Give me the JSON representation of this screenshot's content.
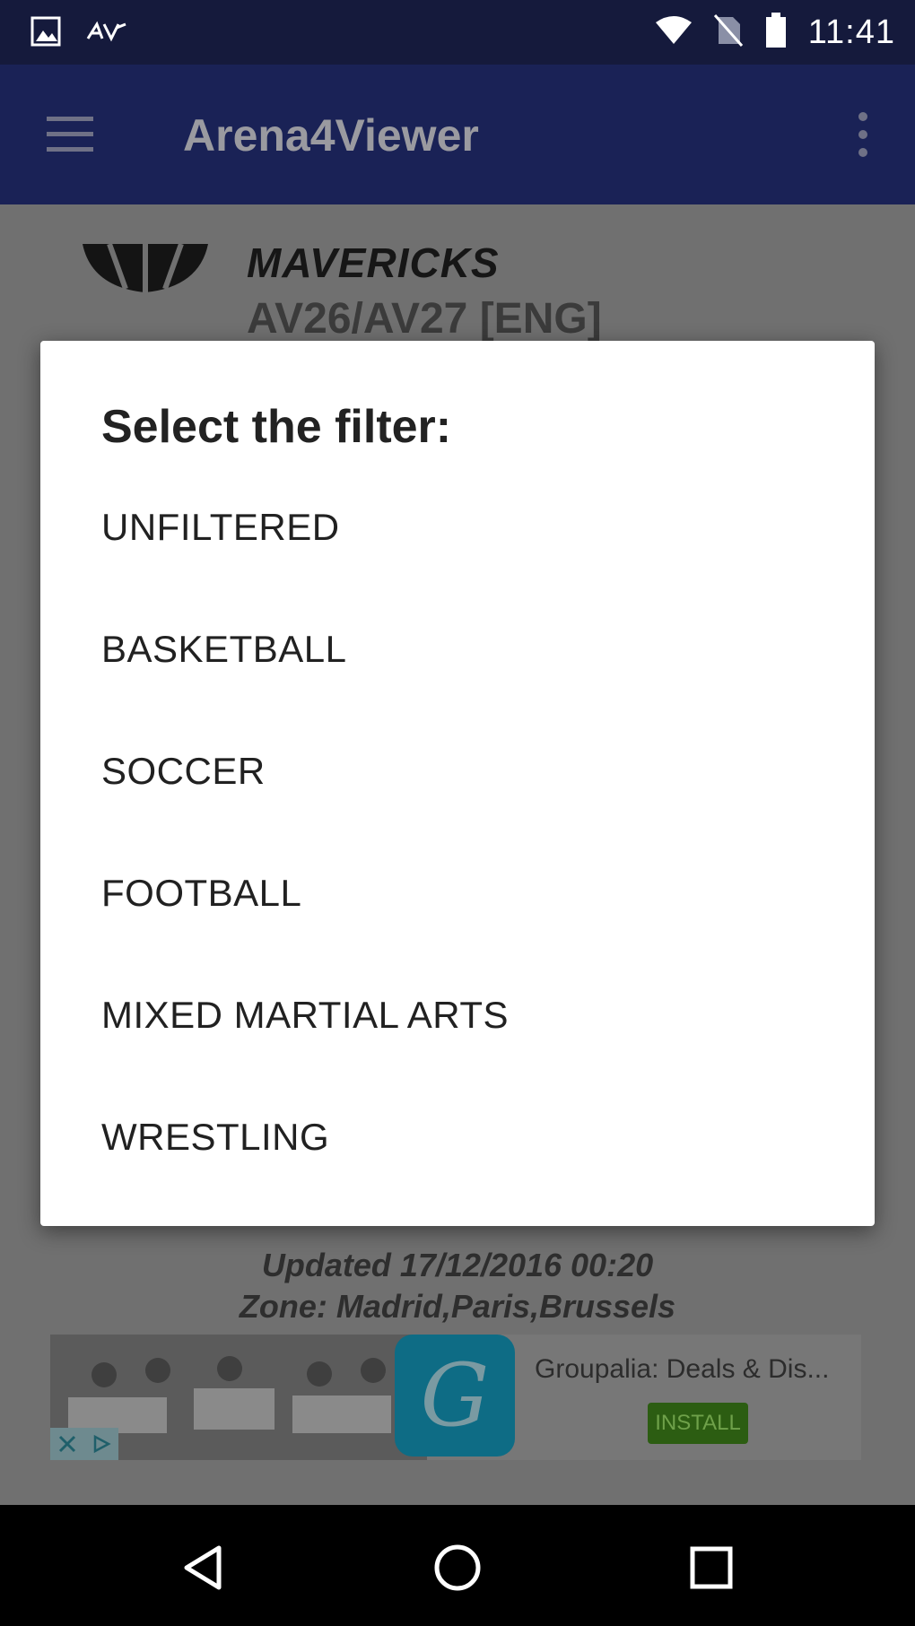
{
  "status_bar": {
    "time": "11:41",
    "left_icons": [
      "image-icon",
      "arena4viewer-logo-icon"
    ],
    "right_icons": [
      "wifi-icon",
      "no-sim-icon",
      "battery-icon"
    ]
  },
  "app_bar": {
    "title": "Arena4Viewer",
    "menu_icon": "hamburger-menu-icon",
    "more_icon": "more-vertical-icon"
  },
  "background_content": {
    "team_name": "MAVERICKS",
    "channel": "AV26/AV27 [ENG]",
    "updated": "Updated 17/12/2016 00:20",
    "zone": "Zone: Madrid,Paris,Brussels"
  },
  "ad": {
    "title": "Groupalia: Deals & Dis...",
    "install_label": "INSTALL",
    "app_icon_letter": "G"
  },
  "dialog": {
    "title": "Select the filter:",
    "options": [
      "UNFILTERED",
      "BASKETBALL",
      "SOCCER",
      "FOOTBALL",
      "MIXED MARTIAL ARTS",
      "WRESTLING"
    ]
  },
  "nav_bar": {
    "buttons": [
      "back-icon",
      "home-icon",
      "recents-icon"
    ]
  },
  "colors": {
    "status_bar": "#151a3c",
    "app_bar": "#1a2256",
    "dialog_bg": "#ffffff",
    "ad_install": "#2c5d12"
  }
}
